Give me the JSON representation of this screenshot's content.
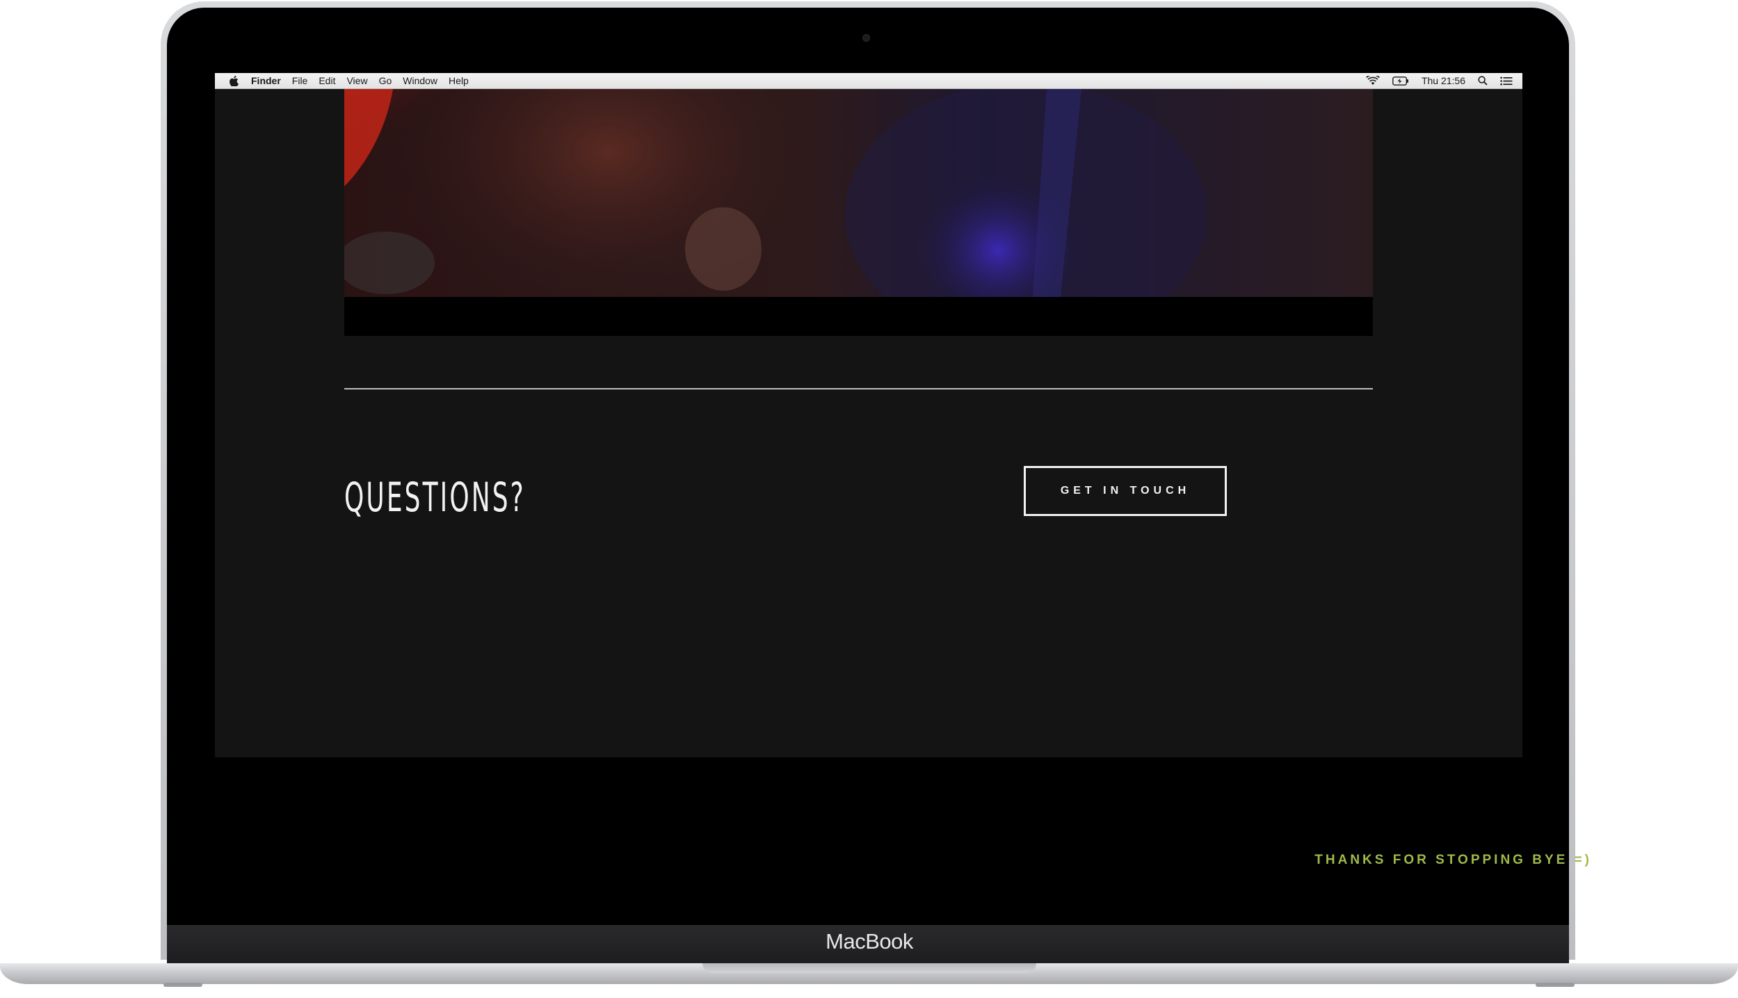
{
  "device": {
    "brand_label": "MacBook"
  },
  "menubar": {
    "app_name": "Finder",
    "items": [
      "File",
      "Edit",
      "View",
      "Go",
      "Window",
      "Help"
    ],
    "clock": "Thu 21:56",
    "icons": [
      "apple-icon",
      "wifi-icon",
      "battery-icon",
      "spotlight-search-icon",
      "notification-center-icon"
    ]
  },
  "page": {
    "heading": "QUESTIONS?",
    "cta_label": "GET IN TOUCH",
    "footer_text": "THANKS FOR STOPPING BYE =)"
  },
  "colors": {
    "page_background": "#141415",
    "accent_footer_text": "#9fba4a",
    "button_border": "#f2f2f2"
  }
}
